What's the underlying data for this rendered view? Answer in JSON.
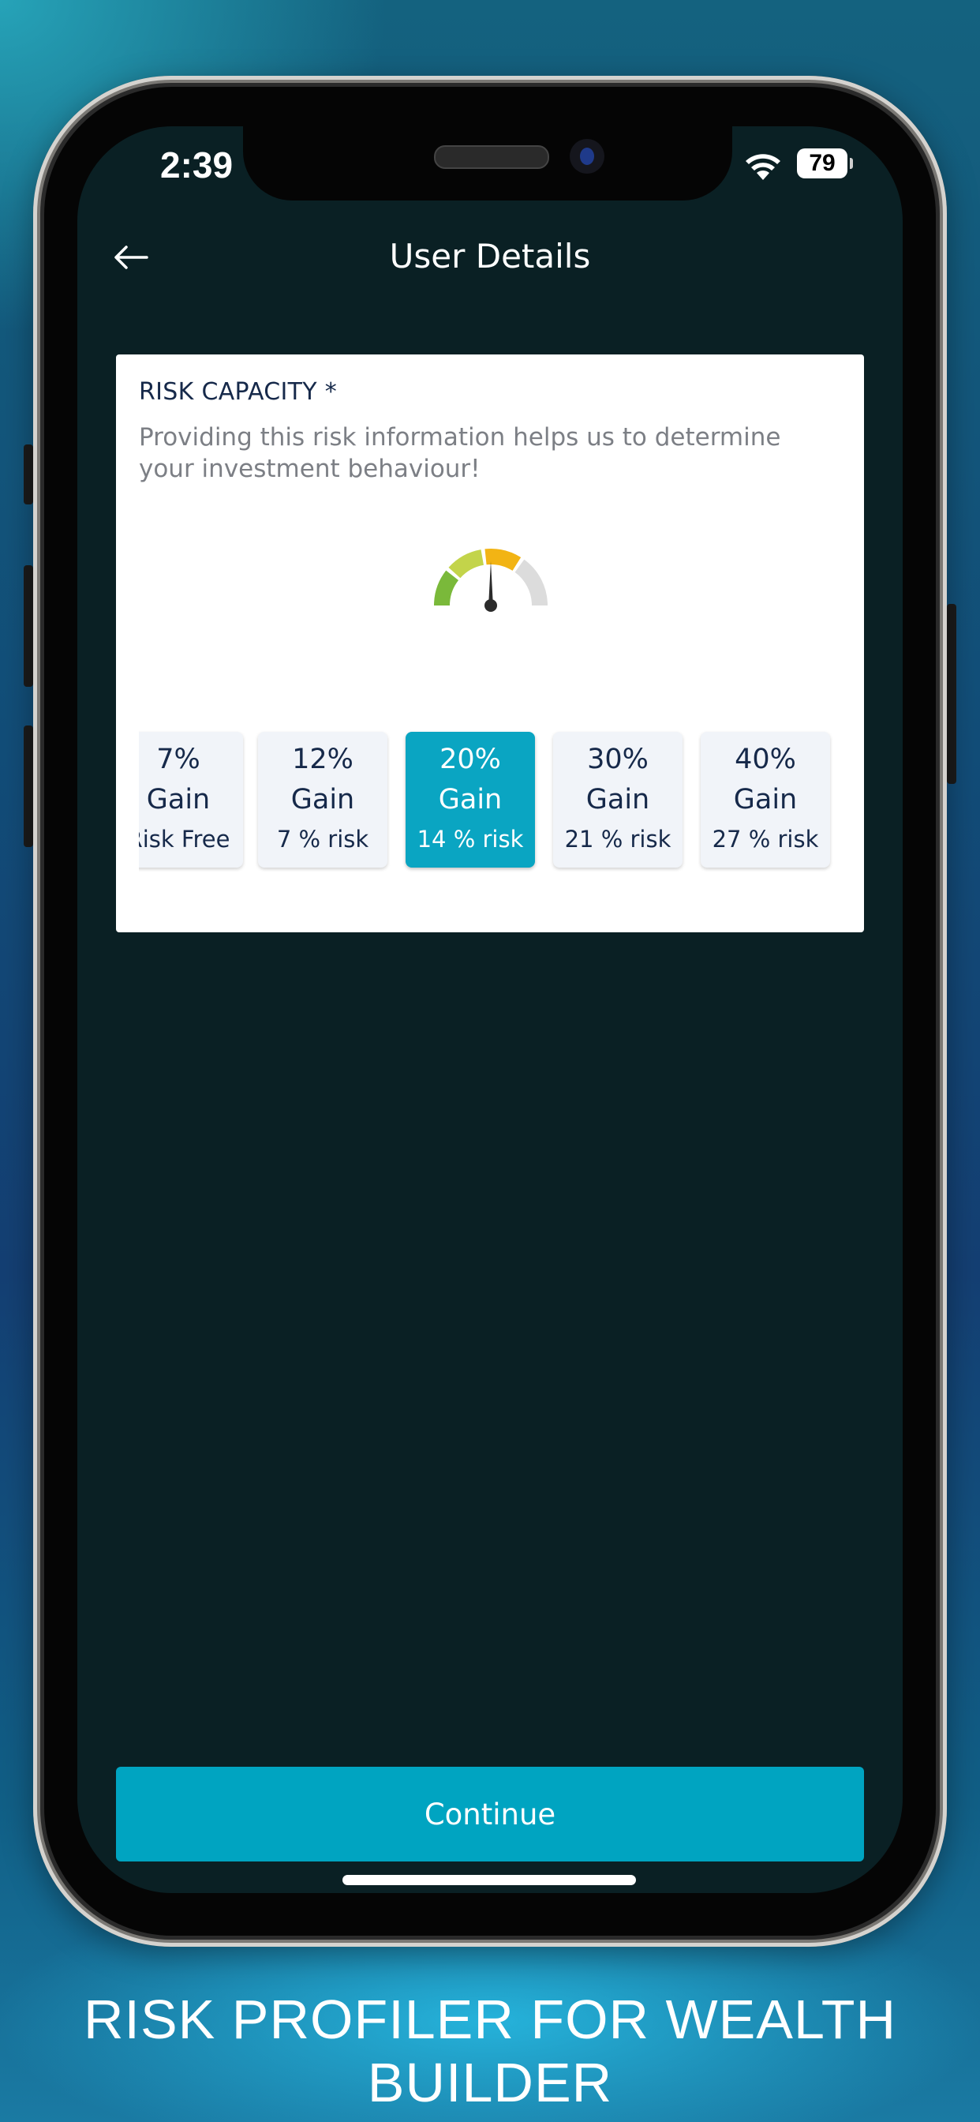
{
  "status_bar": {
    "time": "2:39",
    "battery": "79"
  },
  "header": {
    "back_icon": "arrow-left-icon",
    "title": "User Details"
  },
  "card": {
    "title": "RISK CAPACITY *",
    "description": "Providing this risk information helps us to determine your investment behaviour!",
    "gauge_icon": "risk-gauge-icon",
    "gauge_colors": [
      "#7ab93a",
      "#c3d44a",
      "#f2b414",
      "#dcdcdc"
    ],
    "options": [
      {
        "gain_pct": "7%",
        "gain_word": "Gain",
        "risk": "Risk Free",
        "selected": false
      },
      {
        "gain_pct": "12%",
        "gain_word": "Gain",
        "risk": "7 % risk",
        "selected": false
      },
      {
        "gain_pct": "20%",
        "gain_word": "Gain",
        "risk": "14 % risk",
        "selected": true
      },
      {
        "gain_pct": "30%",
        "gain_word": "Gain",
        "risk": "21 % risk",
        "selected": false
      },
      {
        "gain_pct": "40%",
        "gain_word": "Gain",
        "risk": "27 % risk",
        "selected": false
      }
    ]
  },
  "continue_label": "Continue",
  "caption": "RISK PROFILER FOR WEALTH BUILDER",
  "colors": {
    "accent": "#00a4c1",
    "screen_bg": "#0a2024",
    "card_text": "#16294a"
  }
}
